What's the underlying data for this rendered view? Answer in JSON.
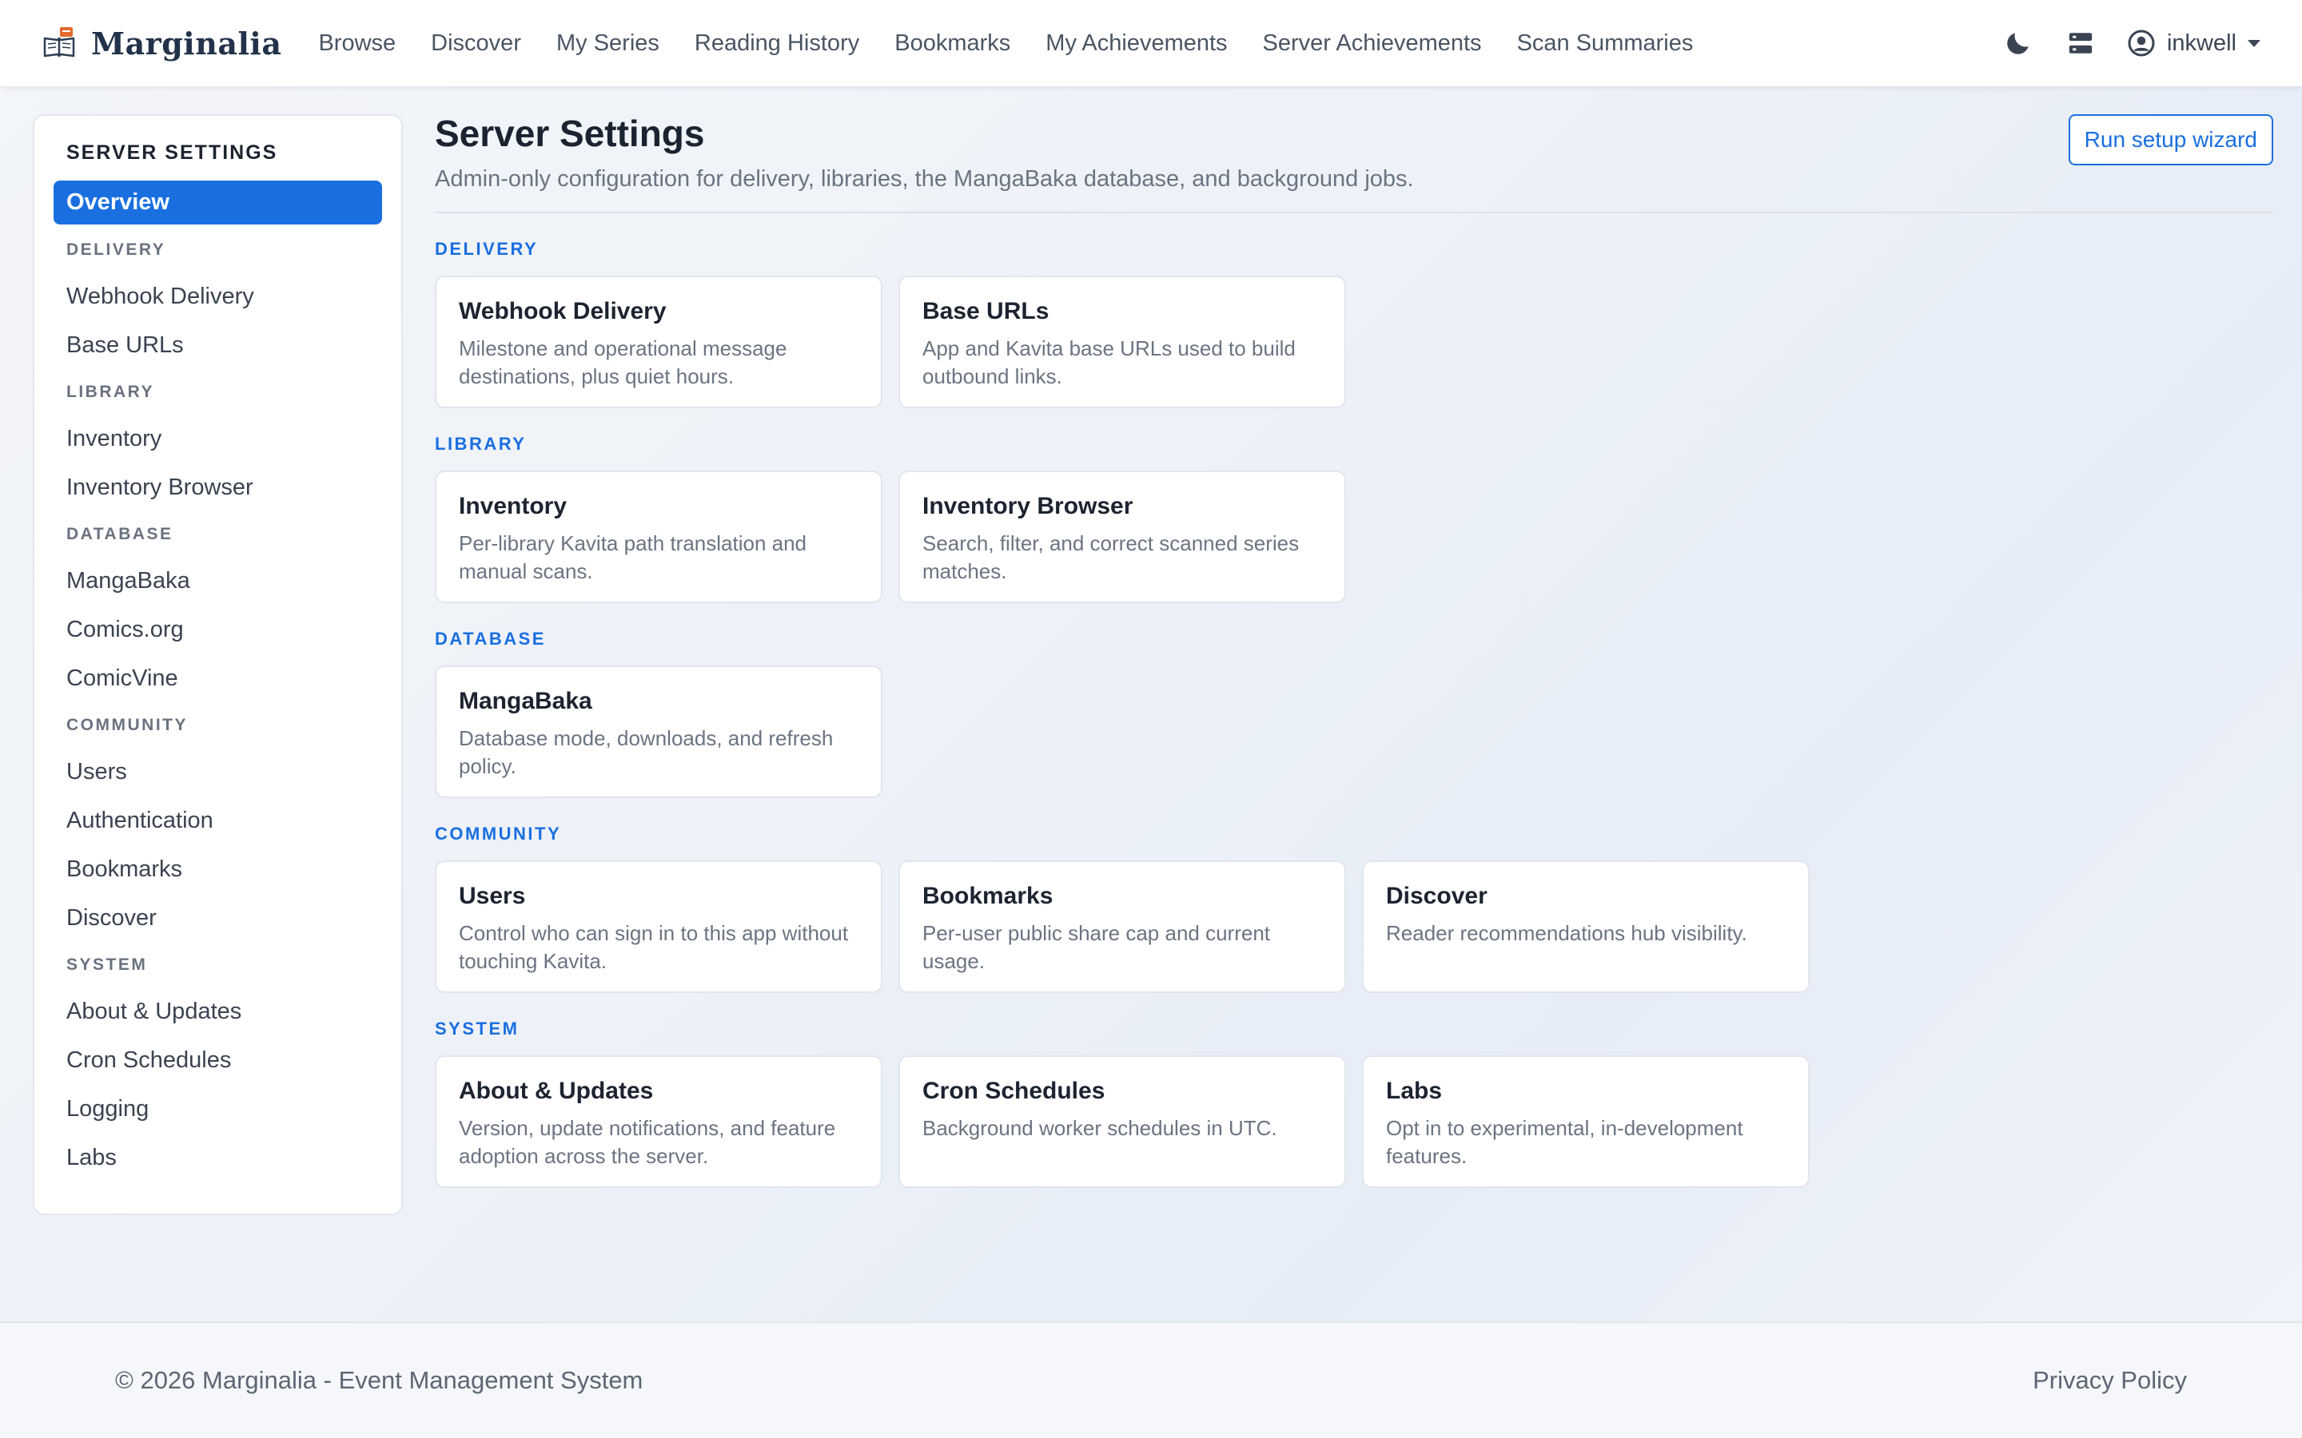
{
  "navbar": {
    "brand": "Marginalia",
    "links": [
      "Browse",
      "Discover",
      "My Series",
      "Reading History",
      "Bookmarks",
      "My Achievements",
      "Server Achievements",
      "Scan Summaries"
    ],
    "icons": [
      "moon-icon",
      "server-icon",
      "user-circle-icon"
    ],
    "user": "inkwell"
  },
  "sidebar": {
    "title": "SERVER SETTINGS",
    "active": "Overview",
    "groups": [
      {
        "label": "DELIVERY",
        "items": [
          "Webhook Delivery",
          "Base URLs"
        ]
      },
      {
        "label": "LIBRARY",
        "items": [
          "Inventory",
          "Inventory Browser"
        ]
      },
      {
        "label": "DATABASE",
        "items": [
          "MangaBaka",
          "Comics.org",
          "ComicVine"
        ]
      },
      {
        "label": "COMMUNITY",
        "items": [
          "Users",
          "Authentication",
          "Bookmarks",
          "Discover"
        ]
      },
      {
        "label": "SYSTEM",
        "items": [
          "About & Updates",
          "Cron Schedules",
          "Logging",
          "Labs"
        ]
      }
    ]
  },
  "main": {
    "title": "Server Settings",
    "subtitle": "Admin-only configuration for delivery, libraries, the MangaBaka database, and background jobs.",
    "wizard_button": "Run setup wizard",
    "sections": [
      {
        "label": "DELIVERY",
        "cards": [
          {
            "title": "Webhook Delivery",
            "desc": "Milestone and operational message destinations, plus quiet hours."
          },
          {
            "title": "Base URLs",
            "desc": "App and Kavita base URLs used to build outbound links."
          }
        ]
      },
      {
        "label": "LIBRARY",
        "cards": [
          {
            "title": "Inventory",
            "desc": "Per-library Kavita path translation and manual scans."
          },
          {
            "title": "Inventory Browser",
            "desc": "Search, filter, and correct scanned series matches."
          }
        ]
      },
      {
        "label": "DATABASE",
        "cards": [
          {
            "title": "MangaBaka",
            "desc": "Database mode, downloads, and refresh policy."
          }
        ]
      },
      {
        "label": "COMMUNITY",
        "cards": [
          {
            "title": "Users",
            "desc": "Control who can sign in to this app without touching Kavita."
          },
          {
            "title": "Bookmarks",
            "desc": "Per-user public share cap and current usage."
          },
          {
            "title": "Discover",
            "desc": "Reader recommendations hub visibility."
          }
        ]
      },
      {
        "label": "SYSTEM",
        "cards": [
          {
            "title": "About & Updates",
            "desc": "Version, update notifications, and feature adoption across the server."
          },
          {
            "title": "Cron Schedules",
            "desc": "Background worker schedules in UTC."
          },
          {
            "title": "Labs",
            "desc": "Opt in to experimental, in-development features."
          }
        ]
      }
    ]
  },
  "footer": {
    "copyright": "© 2026 Marginalia - Event Management System",
    "privacy": "Privacy Policy"
  },
  "colors": {
    "accent": "#1a6fe0",
    "brand_text": "#22324a",
    "muted": "#6b7481"
  }
}
